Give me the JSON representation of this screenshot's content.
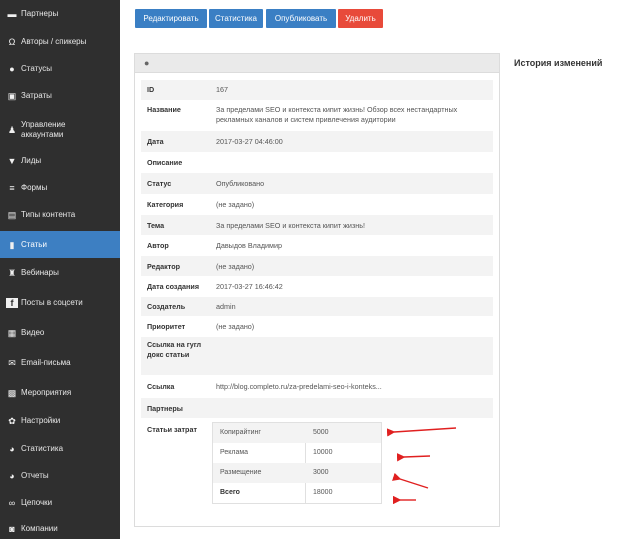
{
  "sidebar": {
    "items": [
      {
        "label": "Партнеры",
        "icon": "handshake-icon",
        "glyph": "▬",
        "active": false
      },
      {
        "label": "Авторы / спикеры",
        "icon": "headset-icon",
        "glyph": "Ω",
        "active": false
      },
      {
        "label": "Статусы",
        "icon": "info-icon",
        "glyph": "●",
        "active": false
      },
      {
        "label": "Затраты",
        "icon": "money-icon",
        "glyph": "▣",
        "active": false
      },
      {
        "label": "Управление аккаунтами",
        "icon": "users-icon",
        "glyph": "♟",
        "active": false
      },
      {
        "label": "Лиды",
        "icon": "filter-icon",
        "glyph": "▼",
        "active": false
      },
      {
        "label": "Формы",
        "icon": "list-icon",
        "glyph": "≡",
        "active": false
      },
      {
        "label": "Типы контента",
        "icon": "table-icon",
        "glyph": "▤",
        "active": false
      },
      {
        "label": "Статьи",
        "icon": "book-icon",
        "glyph": "▮",
        "active": true
      },
      {
        "label": "Вебинары",
        "icon": "user-icon",
        "glyph": "♜",
        "active": false
      },
      {
        "label": "Посты в соцсети",
        "icon": "facebook-icon",
        "glyph": "f",
        "active": false
      },
      {
        "label": "Видео",
        "icon": "film-icon",
        "glyph": "▦",
        "active": false
      },
      {
        "label": "Email-письма",
        "icon": "envelope-icon",
        "glyph": "✉",
        "active": false
      },
      {
        "label": "Мероприятия",
        "icon": "calendar-icon",
        "glyph": "▩",
        "active": false
      },
      {
        "label": "Настройки",
        "icon": "gears-icon",
        "glyph": "✿",
        "active": false
      },
      {
        "label": "Статистика",
        "icon": "pie-chart-icon",
        "glyph": "◕",
        "active": false
      },
      {
        "label": "Отчеты",
        "icon": "pie-chart-icon",
        "glyph": "◕",
        "active": false
      },
      {
        "label": "Цепочки",
        "icon": "link-icon",
        "glyph": "∞",
        "active": false
      },
      {
        "label": "Компании",
        "icon": "building-icon",
        "glyph": "◙",
        "active": false
      }
    ]
  },
  "toolbar": {
    "edit": "Редактировать",
    "stats": "Статистика",
    "publish": "Опубликовать",
    "delete": "Удалить"
  },
  "details": [
    {
      "label": "ID",
      "value": "167"
    },
    {
      "label": "Название",
      "value": "За пределами SEO и контекста кипит жизнь! Обзор всех нестандартных рекламных каналов и систем привлечения аудитории"
    },
    {
      "label": "Дата",
      "value": "2017-03-27 04:46:00"
    },
    {
      "label": "Описание",
      "value": ""
    },
    {
      "label": "Статус",
      "value": "Опубликовано"
    },
    {
      "label": "Категория",
      "value": "(не задано)"
    },
    {
      "label": "Тема",
      "value": "За пределами SEO и контекста кипит жизнь!"
    },
    {
      "label": "Автор",
      "value": "Давыдов Владимир"
    },
    {
      "label": "Редактор",
      "value": "(не задано)"
    },
    {
      "label": "Дата создания",
      "value": "2017-03-27 16:46:42"
    },
    {
      "label": "Создатель",
      "value": "admin"
    },
    {
      "label": "Приоритет",
      "value": "(не задано)"
    },
    {
      "label": "Ссылка на гугл докс статьи",
      "value": ""
    },
    {
      "label": "Ссылка",
      "value": "http://blog.completo.ru/za-predelami-seo-i-konteks..."
    },
    {
      "label": "Партнеры",
      "value": ""
    },
    {
      "label": "Статьи затрат",
      "value": ""
    }
  ],
  "expenses": [
    {
      "label": "Копирайтинг",
      "value": "5000"
    },
    {
      "label": "Реклама",
      "value": "10000"
    },
    {
      "label": "Размещение",
      "value": "3000"
    },
    {
      "label": "Всего",
      "value": "18000"
    }
  ],
  "history_title": "История изменений",
  "colors": {
    "sidebar": "#2f2f2f",
    "active": "#3d7fc2",
    "button": "#3a7fc4",
    "danger": "#e84a3a",
    "arrow": "#e02020"
  }
}
